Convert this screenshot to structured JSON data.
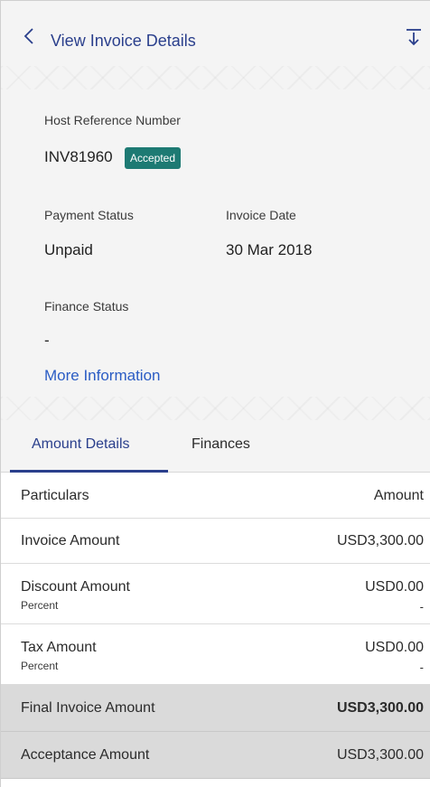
{
  "header": {
    "title": "View Invoice Details",
    "back_icon": "chevron-left-icon",
    "download_icon": "download-icon",
    "accent_color": "#2a3f8c"
  },
  "info": {
    "host_ref_label": "Host Reference Number",
    "host_ref_value": "INV81960",
    "status_badge": "Accepted",
    "status_badge_color": "#1d7a73",
    "payment_status_label": "Payment Status",
    "payment_status_value": "Unpaid",
    "invoice_date_label": "Invoice Date",
    "invoice_date_value": "30 Mar 2018",
    "finance_status_label": "Finance Status",
    "finance_status_value": "-",
    "more_info_link": "More Information"
  },
  "tabs": [
    {
      "label": "Amount Details",
      "active": true
    },
    {
      "label": "Finances",
      "active": false
    }
  ],
  "table": {
    "headers": {
      "particulars": "Particulars",
      "amount": "Amount"
    },
    "rows": [
      {
        "label": "Invoice Amount",
        "value": "USD3,300.00"
      },
      {
        "label": "Discount Amount",
        "sublabel": "Percent",
        "value": "USD0.00",
        "subvalue": "-"
      },
      {
        "label": "Tax Amount",
        "sublabel": "Percent",
        "value": "USD0.00",
        "subvalue": "-"
      },
      {
        "label": "Final Invoice Amount",
        "value": "USD3,300.00"
      },
      {
        "label": "Acceptance Amount",
        "value": "USD3,300.00"
      }
    ]
  }
}
